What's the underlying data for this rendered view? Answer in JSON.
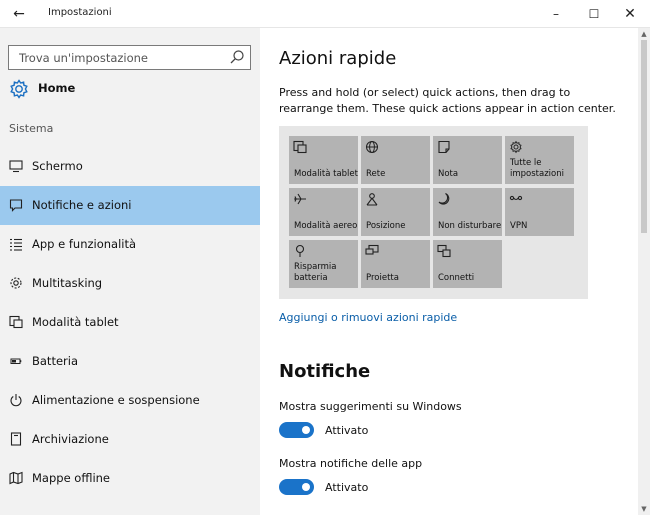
{
  "window": {
    "title": "Impostazioni",
    "back_glyph": "←",
    "minimize_glyph": "–",
    "maximize_glyph": "☐",
    "close_glyph": "✕"
  },
  "sidebar": {
    "search_placeholder": "Trova un'impostazione",
    "home_label": "Home",
    "section_label": "Sistema",
    "items": [
      {
        "label": "Schermo",
        "icon": "monitor-icon"
      },
      {
        "label": "Notifiche e azioni",
        "icon": "notification-icon",
        "selected": true
      },
      {
        "label": "App e funzionalità",
        "icon": "apps-list-icon"
      },
      {
        "label": "Multitasking",
        "icon": "multitasking-icon"
      },
      {
        "label": "Modalità tablet",
        "icon": "tablet-mode-icon"
      },
      {
        "label": "Batteria",
        "icon": "battery-icon"
      },
      {
        "label": "Alimentazione e sospensione",
        "icon": "power-icon"
      },
      {
        "label": "Archiviazione",
        "icon": "storage-icon"
      },
      {
        "label": "Mappe offline",
        "icon": "map-icon"
      }
    ]
  },
  "content": {
    "quick_actions_title": "Azioni rapide",
    "quick_actions_desc": "Press and hold (or select) quick actions, then drag to rearrange them. These quick actions appear in action center.",
    "tiles": [
      {
        "label": "Modalità tablet",
        "icon": "tablet-mode-icon"
      },
      {
        "label": "Rete",
        "icon": "globe-icon"
      },
      {
        "label": "Nota",
        "icon": "note-icon"
      },
      {
        "label": "Tutte le impostazioni",
        "icon": "gear-icon"
      },
      {
        "label": "Modalità aereo",
        "icon": "airplane-icon"
      },
      {
        "label": "Posizione",
        "icon": "location-icon"
      },
      {
        "label": "Non disturbare",
        "icon": "moon-icon"
      },
      {
        "label": "VPN",
        "icon": "vpn-icon"
      },
      {
        "label": "Risparmia batteria",
        "icon": "battery-saver-icon"
      },
      {
        "label": "Proietta",
        "icon": "project-icon"
      },
      {
        "label": "Connetti",
        "icon": "connect-icon"
      }
    ],
    "add_remove_link": "Aggiungi o rimuovi azioni rapide",
    "notifications_title": "Notifiche",
    "settings": [
      {
        "label": "Mostra suggerimenti su Windows",
        "state": "Attivato",
        "on": true
      },
      {
        "label": "Mostra notifiche delle app",
        "state": "Attivato",
        "on": true
      }
    ]
  },
  "colors": {
    "accent": "#1a73c9",
    "selected_nav": "#9bc9ee",
    "link": "#0a5ea8",
    "tile": "#b3b3b3"
  }
}
